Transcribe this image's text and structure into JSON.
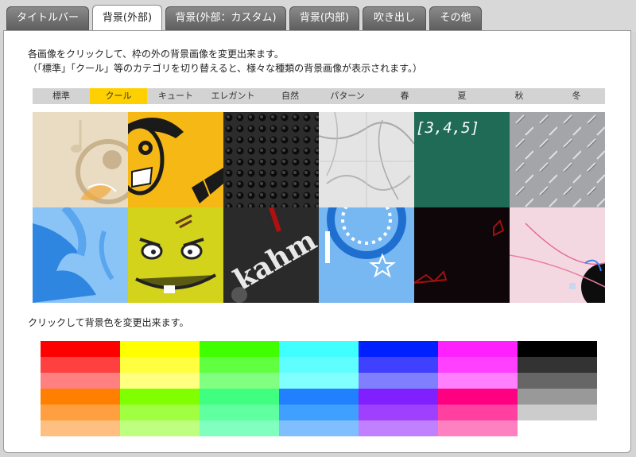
{
  "tabs": [
    {
      "label": "タイトルバー"
    },
    {
      "label": "背景(外部)"
    },
    {
      "label": "背景(外部：カスタム)"
    },
    {
      "label": "背景(内部)"
    },
    {
      "label": "吹き出し"
    },
    {
      "label": "その他"
    }
  ],
  "instructions": {
    "line1": "各画像をクリックして、枠の外の背景画像を変更出来ます。",
    "line2": "（「標準」「クール」等のカテゴリを切り替えると、様々な種類の背景画像が表示されます。）"
  },
  "categories": [
    "標準",
    "クール",
    "キュート",
    "エレガント",
    "自然",
    "パターン",
    "春",
    "夏",
    "秋",
    "冬"
  ],
  "selected_category": "クール",
  "thumbnails": {
    "summer_text": "[3,4,5]",
    "graffiti_text": "kahm"
  },
  "color_caption": "クリックして背景色を変更出来ます。",
  "colors": [
    [
      "#ff0000",
      "#ff4040",
      "#ff8080",
      "#ff8000",
      "#ff9f40",
      "#ffbf80"
    ],
    [
      "#ffff00",
      "#ffff40",
      "#ffff80",
      "#80ff00",
      "#9fff40",
      "#bfff80"
    ],
    [
      "#40ff00",
      "#60ff40",
      "#80ff80",
      "#40ff80",
      "#60ffa0",
      "#80ffbf"
    ],
    [
      "#40ffff",
      "#60ffff",
      "#80ffff",
      "#2080ff",
      "#40a0ff",
      "#80bfff"
    ],
    [
      "#0020ff",
      "#4040ff",
      "#8080ff",
      "#8020ff",
      "#a040ff",
      "#c080ff"
    ],
    [
      "#ff20ff",
      "#ff40ff",
      "#ff80ff",
      "#ff0080",
      "#ff40a0",
      "#ff80c0"
    ],
    [
      "#000000",
      "#333333",
      "#666666",
      "#999999",
      "#cccccc",
      "#ffffff"
    ]
  ]
}
